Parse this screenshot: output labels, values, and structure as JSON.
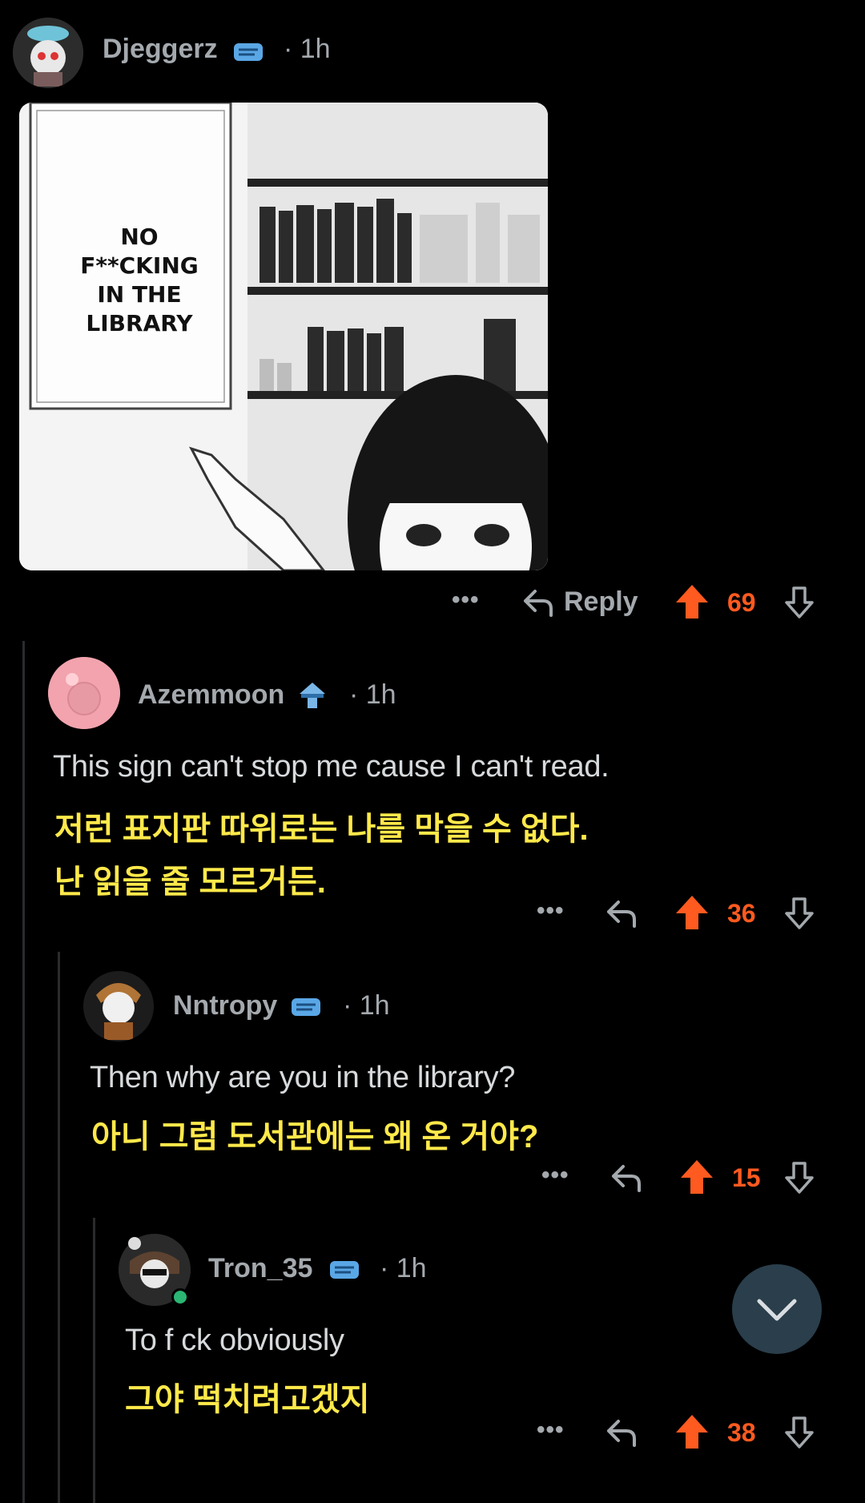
{
  "comments": [
    {
      "username": "Djeggerz",
      "time": "· 1h",
      "sign_text": [
        "NO",
        "F**CKING",
        "IN THE",
        "LIBRARY"
      ],
      "actions": {
        "more": "•••",
        "reply_label": "Reply",
        "score": "69"
      }
    },
    {
      "username": "Azemmoon",
      "time": "· 1h",
      "body_en": "This sign can't stop me cause I can't read.",
      "body_ko_1": "저런 표지판 따위로는 나를 막을 수 없다.",
      "body_ko_2": "난 읽을 줄 모르거든.",
      "actions": {
        "more": "•••",
        "score": "36"
      }
    },
    {
      "username": "Nntropy",
      "time": "· 1h",
      "body_en": "Then why are you in the library?",
      "body_ko_1": "아니 그럼 도서관에는 왜 온 거야?",
      "actions": {
        "more": "•••",
        "score": "15"
      }
    },
    {
      "username": "Tron_35",
      "time": "· 1h",
      "body_en": "To f ck obviously",
      "body_ko_1": "그야 떡치려고겠지",
      "actions": {
        "more": "•••",
        "score": "38"
      }
    }
  ],
  "colors": {
    "upvote": "#ff5a1f",
    "meta": "#a4a9ae",
    "korean_caption": "#ffe94a",
    "scroll_button": "#2a3e4b"
  },
  "icons": {
    "flair": "flair-badge-icon",
    "reply": "reply-arrow-icon",
    "upvote": "upvote-arrow-icon",
    "downvote": "downvote-arrow-icon",
    "scroll": "chevron-down-icon"
  }
}
